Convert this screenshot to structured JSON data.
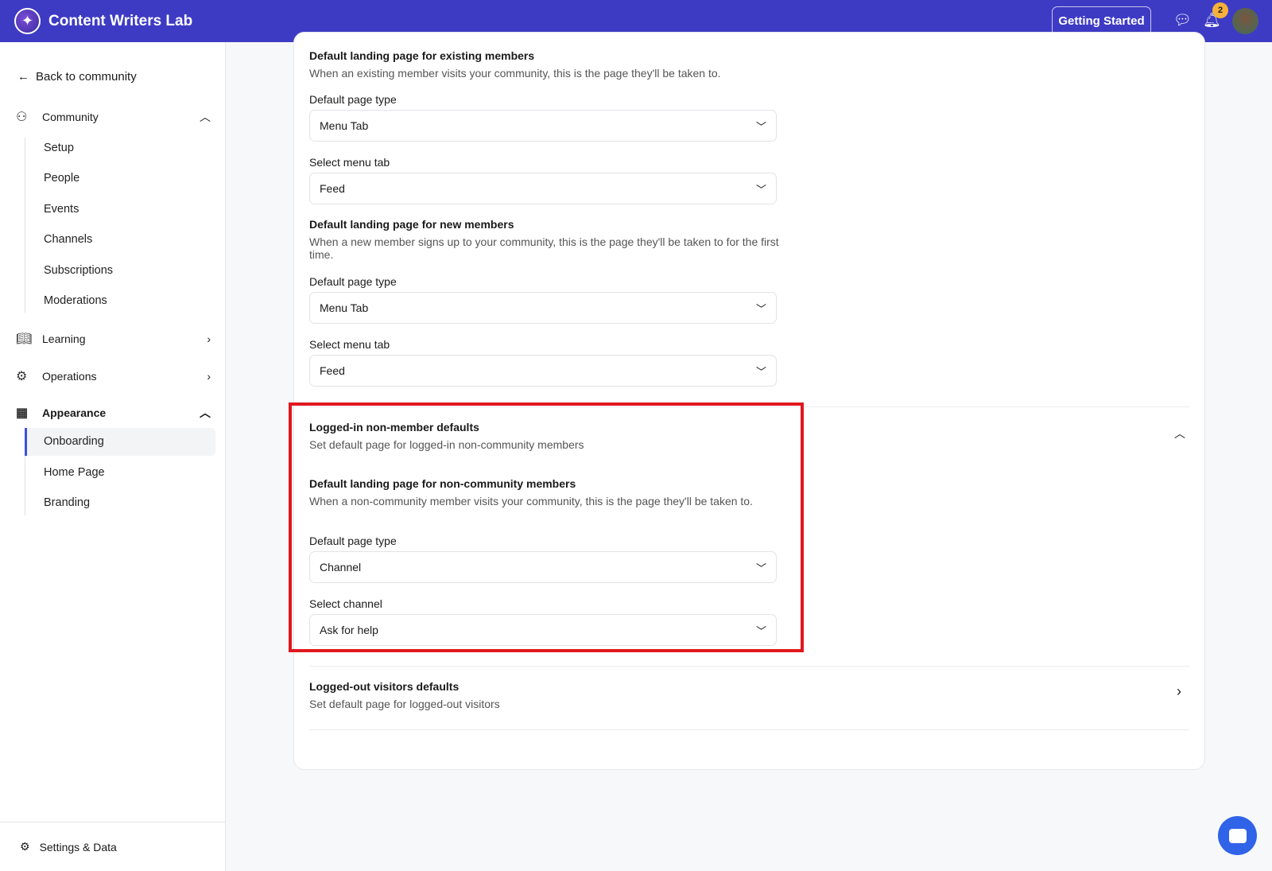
{
  "header": {
    "title": "Content Writers Lab",
    "getting_started": "Getting Started",
    "notification_count": "2"
  },
  "sidebar": {
    "back": "Back to community",
    "community": {
      "label": "Community",
      "items": [
        "Setup",
        "People",
        "Events",
        "Channels",
        "Subscriptions",
        "Moderations"
      ]
    },
    "learning": "Learning",
    "operations": "Operations",
    "appearance": {
      "label": "Appearance",
      "items": [
        "Onboarding",
        "Home Page",
        "Branding"
      ],
      "active": "Onboarding"
    },
    "settings": "Settings & Data"
  },
  "main": {
    "existing": {
      "title": "Default landing page for existing members",
      "desc": "When an existing member visits your community, this is the page they'll be taken to.",
      "type_label": "Default page type",
      "type_value": "Menu Tab",
      "tab_label": "Select menu tab",
      "tab_value": "Feed"
    },
    "new": {
      "title": "Default landing page for new members",
      "desc": "When a new member signs up to your community, this is the page they'll be taken to for the first time.",
      "type_label": "Default page type",
      "type_value": "Menu Tab",
      "tab_label": "Select menu tab",
      "tab_value": "Feed"
    },
    "nonmember": {
      "title": "Logged-in non-member defaults",
      "subtitle": "Set default page for logged-in non-community members",
      "section": "Default landing page for non-community members",
      "desc": "When a non-community member visits your community, this is the page they'll be taken to.",
      "type_label": "Default page type",
      "type_value": "Channel",
      "channel_label": "Select channel",
      "channel_value": "Ask for help"
    },
    "loggedout": {
      "title": "Logged-out visitors defaults",
      "subtitle": "Set default page for logged-out visitors"
    }
  }
}
